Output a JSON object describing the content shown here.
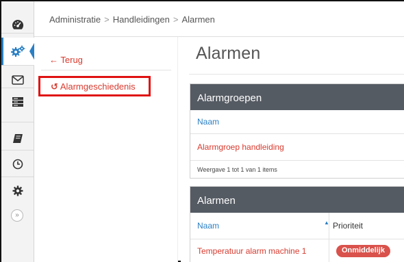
{
  "rail": {
    "items": [
      {
        "name": "dashboard-icon"
      },
      {
        "name": "settings-cogs-icon"
      },
      {
        "name": "envelope-icon"
      },
      {
        "name": "server-icon"
      },
      {
        "name": "book-icon"
      },
      {
        "name": "clock-icon"
      },
      {
        "name": "gear-icon"
      }
    ],
    "collapse_label": "»"
  },
  "breadcrumb": {
    "items": [
      "Administratie",
      "Handleidingen",
      "Alarmen"
    ],
    "separator": ">"
  },
  "subnav": {
    "back_arrow": "←",
    "back_label": "Terug",
    "history_icon": "↺",
    "history_label": "Alarmgeschiedenis"
  },
  "main": {
    "title": "Alarmen",
    "groups_panel": {
      "title": "Alarmgroepen",
      "column_header": "Naam",
      "rows": [
        "Alarmgroep handleiding"
      ],
      "footer": "Weergave 1 tot 1 van 1 items"
    },
    "alarms_panel": {
      "title": "Alarmen",
      "column_name": "Naam",
      "sort_indicator": "▲",
      "column_priority": "Prioriteit",
      "rows": [
        {
          "name": "Temperatuur alarm machine 1",
          "priority": "Onmiddelijk"
        }
      ]
    }
  },
  "colors": {
    "accent_blue": "#2a7fc4",
    "link_red": "#d83a2e",
    "highlight_box": "#e01111",
    "panel_header": "#555b63",
    "badge_red": "#d9524b"
  }
}
